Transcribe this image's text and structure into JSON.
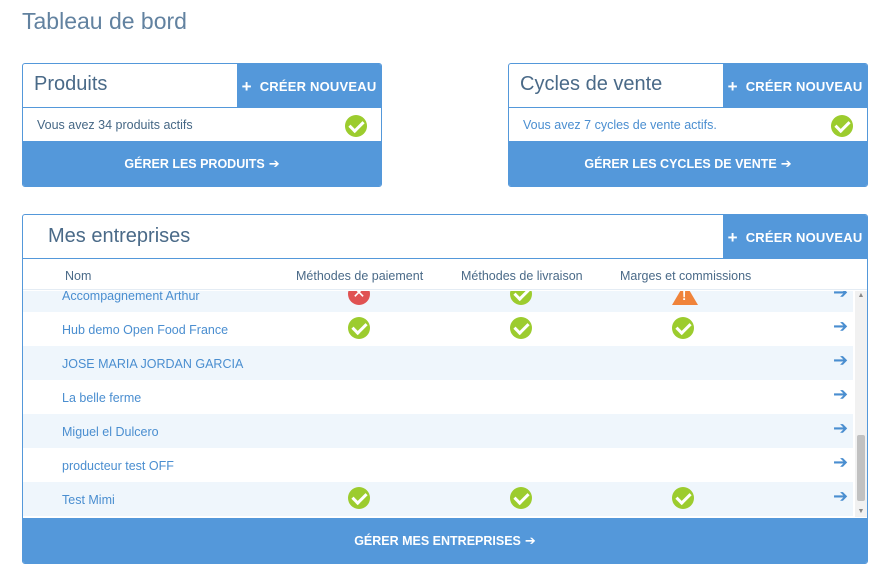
{
  "page": {
    "title": "Tableau de bord"
  },
  "products": {
    "title": "Produits",
    "create_label": "CRÉER NOUVEAU",
    "info": "Vous avez 34 produits actifs",
    "footer_label": "GÉRER LES PRODUITS"
  },
  "cycles": {
    "title": "Cycles de vente",
    "create_label": "CRÉER NOUVEAU",
    "info": "Vous avez 7 cycles de vente actifs.",
    "footer_label": "GÉRER LES CYCLES DE VENTE"
  },
  "enterprises": {
    "title": "Mes entreprises",
    "create_label": "CRÉER NOUVEAU",
    "columns": [
      "Nom",
      "Méthodes de paiement",
      "Méthodes de livraison",
      "Marges et commissions"
    ],
    "rows": [
      {
        "name": "Accompagnement Arthur",
        "payment": "error",
        "shipping": "ok",
        "fees": "warning"
      },
      {
        "name": "Hub demo Open Food France",
        "payment": "ok",
        "shipping": "ok",
        "fees": "ok"
      },
      {
        "name": "JOSE MARIA JORDAN GARCIA",
        "payment": "",
        "shipping": "",
        "fees": ""
      },
      {
        "name": "La belle ferme",
        "payment": "",
        "shipping": "",
        "fees": ""
      },
      {
        "name": "Miguel el Dulcero",
        "payment": "",
        "shipping": "",
        "fees": ""
      },
      {
        "name": "producteur test OFF",
        "payment": "",
        "shipping": "",
        "fees": ""
      },
      {
        "name": "Test Mimi",
        "payment": "ok",
        "shipping": "ok",
        "fees": "ok"
      }
    ],
    "footer_label": "GÉRER MES ENTREPRISES"
  },
  "icons": {
    "plus": "plus-icon",
    "arrow": "arrow-right-icon",
    "ok": "check-circle-icon",
    "error": "error-circle-icon",
    "warning": "warning-triangle-icon"
  },
  "colors": {
    "accent": "#5498da",
    "ok": "#9ccc2e",
    "error": "#e05252",
    "warning": "#f0833a",
    "row_alt": "#eff6fc"
  }
}
